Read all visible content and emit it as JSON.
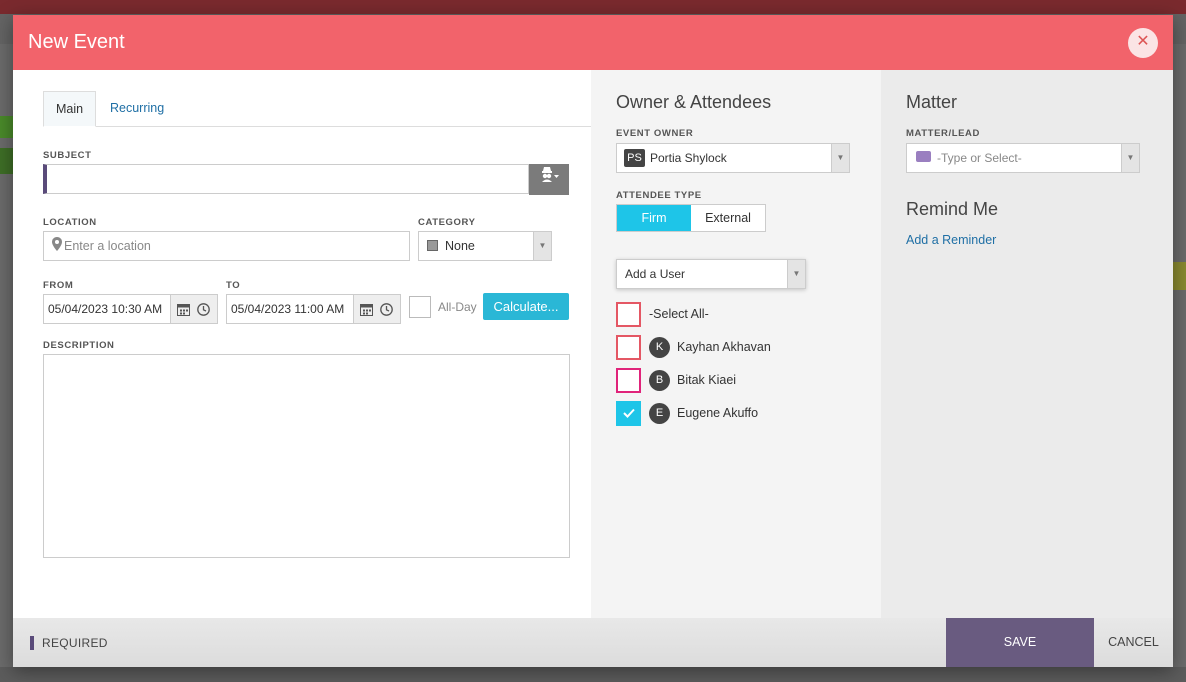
{
  "header": {
    "title": "New Event",
    "close_glyph": "✕"
  },
  "tabs": {
    "main": "Main",
    "recurring": "Recurring"
  },
  "form": {
    "subject_label": "SUBJECT",
    "subject_value": "",
    "location_label": "LOCATION",
    "location_placeholder": "Enter a location",
    "category_label": "CATEGORY",
    "category_value": "None",
    "from_label": "FROM",
    "from_value": "05/04/2023 10:30 AM",
    "to_label": "TO",
    "to_value": "05/04/2023 11:00 AM",
    "allday_label": "All-Day",
    "calculate_label": "Calculate...",
    "description_label": "DESCRIPTION"
  },
  "owner": {
    "section_title": "Owner & Attendees",
    "event_owner_label": "EVENT OWNER",
    "owner_initials": "PS",
    "owner_name": "Portia Shylock",
    "attendee_type_label": "ATTENDEE TYPE",
    "type_firm": "Firm",
    "type_external": "External",
    "add_user_label": "Add a User",
    "select_all_label": "-Select All-",
    "attendees": [
      {
        "initial": "K",
        "name": "Kayhan Akhavan",
        "checked": false
      },
      {
        "initial": "B",
        "name": "Bitak Kiaei",
        "checked": false
      },
      {
        "initial": "E",
        "name": "Eugene Akuffo",
        "checked": true
      }
    ]
  },
  "matter": {
    "section_title": "Matter",
    "matter_label": "MATTER/LEAD",
    "matter_placeholder": "-Type or Select-",
    "remind_title": "Remind Me",
    "add_reminder": "Add a Reminder"
  },
  "footer": {
    "required_label": "REQUIRED",
    "save_label": "SAVE",
    "cancel_label": "CANCEL"
  },
  "colors": {
    "header": "#f2636b",
    "accent": "#1ec5e8",
    "save": "#695b80",
    "link": "#1f6fa5"
  }
}
